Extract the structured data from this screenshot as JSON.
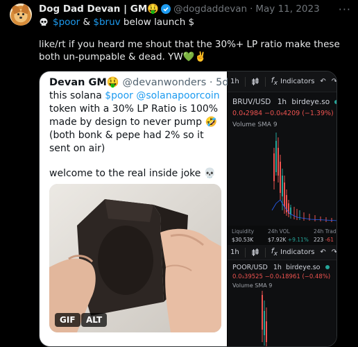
{
  "tweet": {
    "name": "Dog Dad Devan | GM🤑",
    "handle": "@dogdaddevan",
    "date": "May 11, 2023",
    "line1": {
      "cash1": "$poor",
      "amp": " & ",
      "cash2": "$bruv",
      "rest": " below launch $"
    },
    "text": "like/rt if you heard me shout that the 30%+ LP ratio make these both un-pumpable & dead. YW💚✌️"
  },
  "quote": {
    "name": "Devan GM🤑",
    "handle": "@devanwonders",
    "time": "5d",
    "body1_pre": "this solana ",
    "cash": "$poor",
    "mention": "@solanapoorcoin",
    "body1_post": " token with a 30% LP Ratio is 100% made by design to never pump 🤣 (both bonk & pepe had 2% so it sent on air)",
    "body2": "welcome to the real inside joke 💀",
    "gif_label": "GIF",
    "alt_label": "ALT"
  },
  "chart_top": {
    "timeframe": "1h",
    "indicators_label": "Indicators",
    "symbol": "BRUV/USD",
    "interval": "1h",
    "source": "birdeye.so",
    "price": "0.0₄2984",
    "change": "−0.0₆4209 (−1.39%)",
    "volume": "Volume SMA 9"
  },
  "stats": {
    "liquidity_label": "Liquidity",
    "liquidity_value": "$30.53K",
    "vol_label": "24h VOL",
    "vol_value": "$7.92K",
    "vol_change": "+9.11%",
    "trades_label": "24h Trad",
    "trades_value": "223",
    "trades_change": "-61"
  },
  "chart_bottom": {
    "timeframe": "1h",
    "indicators_label": "Indicators",
    "symbol": "POOR/USD",
    "interval": "1h",
    "source": "birdeye.so",
    "price": "0.0₃39525",
    "change": "−0.0₃18961 (−0.48%)",
    "volume": "Volume SMA 9"
  },
  "colors": {
    "background": "#000000",
    "link": "#1d9bf0",
    "muted": "#71767b",
    "up": "#26a69a",
    "down": "#ef5350"
  },
  "icons": [
    "verified-badge-icon",
    "more-icon",
    "skull-icon",
    "candles-icon",
    "fx-icon",
    "undo-icon",
    "redo-icon"
  ]
}
